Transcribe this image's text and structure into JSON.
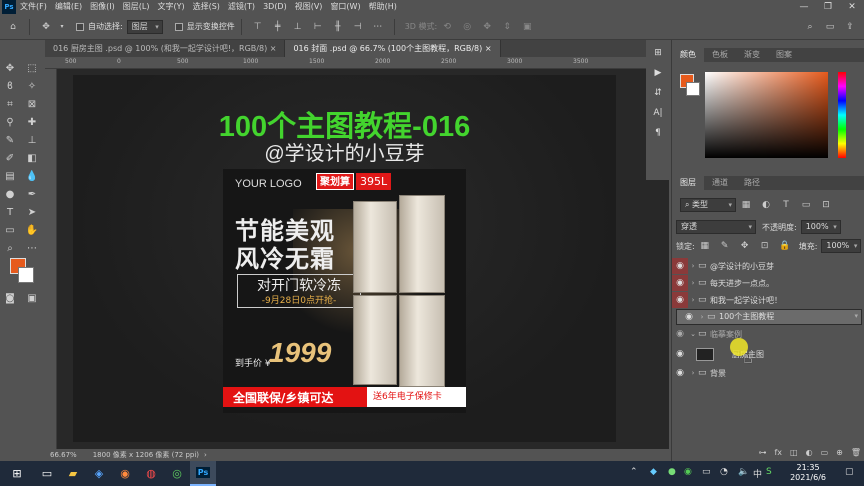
{
  "menubar": {
    "items": [
      "文件(F)",
      "编辑(E)",
      "图像(I)",
      "图层(L)",
      "文字(Y)",
      "选择(S)",
      "滤镜(T)",
      "3D(D)",
      "视图(V)",
      "窗口(W)",
      "帮助(H)"
    ],
    "app_badge": "Ps"
  },
  "options": {
    "auto_select_label": "自动选择:",
    "auto_select_value": "图层",
    "show_transform_label": "显示变换控件",
    "mode_3d_label": "3D 模式:"
  },
  "tabs": [
    {
      "label": "016 厨房主图 .psd @ 100% (和我一起学设计吧!，RGB/8)",
      "active": false
    },
    {
      "label": "016 封面 .psd @ 66.7% (100个主图教程，RGB/8)",
      "active": true
    }
  ],
  "ruler_ticks": [
    "500",
    "0",
    "500",
    "1000",
    "1500",
    "2000",
    "2500",
    "3000",
    "3500"
  ],
  "canvas": {
    "title": "100个主图教程-016",
    "subtitle": "@学设计的小豆芽",
    "product": {
      "logo": "YOUR LOGO",
      "badge1": "聚划算",
      "badge2": "395L",
      "headline1": "节能美观",
      "headline2": "风冷无霜",
      "tag": "对开门软冷冻",
      "date": "-9月28日0点开抢-",
      "price_label": "到手价 ¥",
      "price": "1999",
      "ribbon_left": "全国联保/乡镇可达",
      "ribbon_right": "送6年电子保修卡"
    }
  },
  "status": {
    "zoom": "66.67%",
    "doc_size": "1800 像素 x 1206 像素 (72 ppi)"
  },
  "color_panel": {
    "tabs": [
      "颜色",
      "色板",
      "渐变",
      "图案"
    ],
    "fg_color": "#e65a1c"
  },
  "layers_panel": {
    "tabs": [
      "图层",
      "通道",
      "路径"
    ],
    "filter_label": "类型",
    "blend_mode": "穿透",
    "opacity_label": "不透明度:",
    "opacity_value": "100%",
    "lock_label": "锁定:",
    "fill_label": "填充:",
    "fill_value": "100%",
    "layers": [
      {
        "name": "@学设计的小豆芽",
        "style": "red"
      },
      {
        "name": "每天进步一点点。",
        "style": "red"
      },
      {
        "name": "和我一起学设计吧！",
        "style": "red"
      },
      {
        "name": "100个主图教程",
        "style": "sel"
      },
      {
        "name": "临摹案例",
        "style": "dim"
      },
      {
        "name": "厨房主图",
        "style": "smart"
      },
      {
        "name": "背景",
        "style": "normal"
      }
    ]
  },
  "taskbar": {
    "time": "21:35",
    "date": "2021/6/6",
    "lang": "中",
    "ps_label": "Ps"
  }
}
